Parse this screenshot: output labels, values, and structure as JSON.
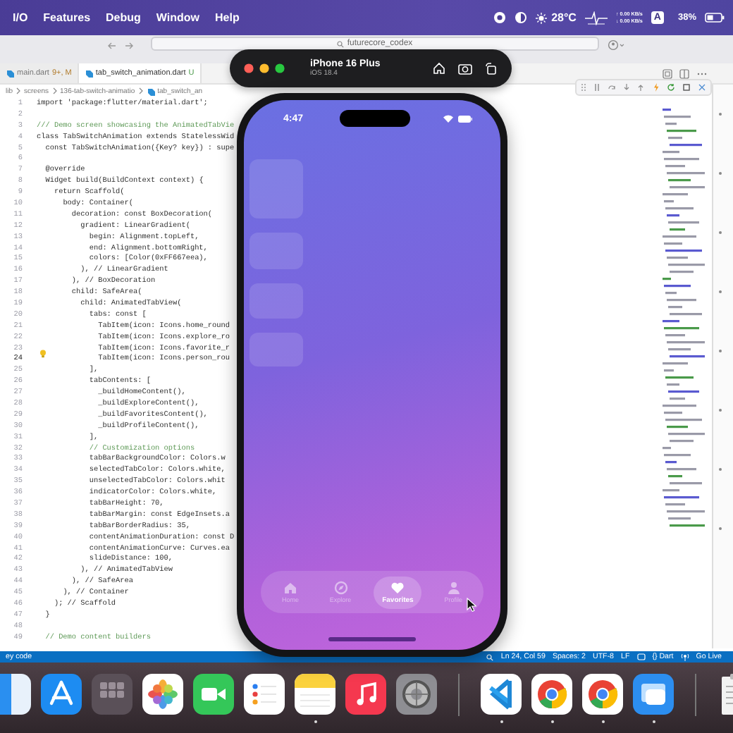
{
  "menu_bar": {
    "items": [
      "I/O",
      "Features",
      "Debug",
      "Window",
      "Help"
    ],
    "weather": "28°C",
    "net_up": "↑ 0.00 KB/s",
    "net_down": "↓ 0.00 KB/s",
    "input_source": "A",
    "battery": "38%"
  },
  "editor": {
    "search": "futurecore_codex",
    "tabs": [
      {
        "label": "main.dart",
        "badge": "9+, M",
        "selected": false
      },
      {
        "label": "tab_switch_animation.dart",
        "badge": "U",
        "selected": true
      }
    ],
    "breadcrumb": [
      "lib",
      "screens",
      "136-tab-switch-animatio",
      "tab_switch_an"
    ],
    "lines": [
      {
        "number": "1",
        "kind": "code",
        "text": "import 'package:flutter/material.dart';",
        "current": false
      },
      {
        "number": "2",
        "current": false
      },
      {
        "number": "3",
        "kind": "comment",
        "text": "/// Demo screen showcasing the AnimatedTabVie",
        "current": false
      },
      {
        "number": "4",
        "kind": "code",
        "text": "class TabSwitchAnimation extends StatelessWid",
        "current": false
      },
      {
        "number": "5",
        "kind": "code",
        "text": "  const TabSwitchAnimation({Key? key}) : supe",
        "current": false
      },
      {
        "number": "6",
        "current": false
      },
      {
        "number": "7",
        "kind": "code",
        "text": "  @override",
        "current": false
      },
      {
        "number": "8",
        "kind": "code",
        "text": "  Widget build(BuildContext context) {",
        "current": false
      },
      {
        "number": "9",
        "kind": "code",
        "text": "    return Scaffold(",
        "current": false
      },
      {
        "number": "10",
        "kind": "code",
        "text": "      body: Container(",
        "current": false
      },
      {
        "number": "11",
        "kind": "code",
        "text": "        decoration: const BoxDecoration(",
        "current": false
      },
      {
        "number": "12",
        "kind": "code",
        "text": "          gradient: LinearGradient(",
        "current": false
      },
      {
        "number": "13",
        "kind": "code",
        "text": "            begin: Alignment.topLeft,",
        "current": false
      },
      {
        "number": "14",
        "kind": "code",
        "text": "            end: Alignment.bottomRight,",
        "current": false
      },
      {
        "number": "15",
        "kind": "code",
        "text": "            colors: [Color(0xFF667eea),",
        "current": false
      },
      {
        "number": "16",
        "kind": "code",
        "text": "          ), // LinearGradient",
        "current": false
      },
      {
        "number": "17",
        "kind": "code",
        "text": "        ), // BoxDecoration",
        "current": false
      },
      {
        "number": "18",
        "kind": "code",
        "text": "        child: SafeArea(",
        "current": false
      },
      {
        "number": "19",
        "kind": "code",
        "text": "          child: AnimatedTabView(",
        "current": false
      },
      {
        "number": "20",
        "kind": "code",
        "text": "            tabs: const [",
        "current": false
      },
      {
        "number": "21",
        "kind": "code",
        "text": "              TabItem(icon: Icons.home_round",
        "current": false
      },
      {
        "number": "22",
        "kind": "code",
        "text": "              TabItem(icon: Icons.explore_ro",
        "current": false
      },
      {
        "number": "23",
        "kind": "code",
        "text": "              TabItem(icon: Icons.favorite_r",
        "current": false
      },
      {
        "number": "24",
        "kind": "code",
        "text": "              TabItem(icon: Icons.person_rou",
        "current": true
      },
      {
        "number": "25",
        "kind": "code",
        "text": "            ],",
        "current": false
      },
      {
        "number": "26",
        "kind": "code",
        "text": "            tabContents: [",
        "current": false
      },
      {
        "number": "27",
        "kind": "code",
        "text": "              _buildHomeContent(),",
        "current": false
      },
      {
        "number": "28",
        "kind": "code",
        "text": "              _buildExploreContent(),",
        "current": false
      },
      {
        "number": "29",
        "kind": "code",
        "text": "              _buildFavoritesContent(),",
        "current": false
      },
      {
        "number": "30",
        "kind": "code",
        "text": "              _buildProfileContent(),",
        "current": false
      },
      {
        "number": "31",
        "kind": "code",
        "text": "            ],",
        "current": false
      },
      {
        "number": "32",
        "kind": "comment",
        "text": "            // Customization options",
        "current": false
      },
      {
        "number": "33",
        "kind": "code",
        "text": "            tabBarBackgroundColor: Colors.w",
        "current": false
      },
      {
        "number": "34",
        "kind": "code",
        "text": "            selectedTabColor: Colors.white,",
        "current": false
      },
      {
        "number": "35",
        "kind": "code",
        "text": "            unselectedTabColor: Colors.whit",
        "current": false
      },
      {
        "number": "36",
        "kind": "code",
        "text": "            indicatorColor: Colors.white,",
        "current": false
      },
      {
        "number": "37",
        "kind": "code",
        "text": "            tabBarHeight: 70,",
        "current": false
      },
      {
        "number": "38",
        "kind": "code",
        "text": "            tabBarMargin: const EdgeInsets.a",
        "current": false
      },
      {
        "number": "39",
        "kind": "code",
        "text": "            tabBarBorderRadius: 35,",
        "current": false
      },
      {
        "number": "40",
        "kind": "code",
        "text": "            contentAnimationDuration: const D",
        "current": false
      },
      {
        "number": "41",
        "kind": "code",
        "text": "            contentAnimationCurve: Curves.ea",
        "current": false
      },
      {
        "number": "42",
        "kind": "code",
        "text": "            slideDistance: 100,",
        "current": false
      },
      {
        "number": "43",
        "kind": "code",
        "text": "          ), // AnimatedTabView",
        "current": false
      },
      {
        "number": "44",
        "kind": "code",
        "text": "        ), // SafeArea",
        "current": false
      },
      {
        "number": "45",
        "kind": "code",
        "text": "      ), // Container",
        "current": false
      },
      {
        "number": "46",
        "kind": "code",
        "text": "    ); // Scaffold",
        "current": false
      },
      {
        "number": "47",
        "kind": "code",
        "text": "  }",
        "current": false
      },
      {
        "number": "48",
        "current": false
      },
      {
        "number": "49",
        "kind": "comment",
        "text": "  // Demo content builders",
        "current": false
      }
    ],
    "status_left": "ey code",
    "status_items": [
      "Ln 24, Col 59",
      "Spaces: 2",
      "UTF-8",
      "LF",
      "{} Dart",
      "Go Live"
    ]
  },
  "simulator": {
    "device": "iPhone 16 Plus",
    "os": "iOS 18.4",
    "time": "4:47",
    "tabs": [
      {
        "label": "Home",
        "selected": false
      },
      {
        "label": "Explore",
        "selected": false
      },
      {
        "label": "Favorites",
        "selected": true
      },
      {
        "label": "Profile",
        "selected": false
      }
    ]
  },
  "dock": [
    {
      "kind": "finder",
      "running": false
    },
    {
      "kind": "store",
      "running": false
    },
    {
      "kind": "launchpad",
      "running": false
    },
    {
      "kind": "photos",
      "running": false
    },
    {
      "kind": "video",
      "running": false
    },
    {
      "kind": "reminders",
      "running": false
    },
    {
      "kind": "notes",
      "running": true
    },
    {
      "kind": "music",
      "running": false
    },
    {
      "kind": "settings",
      "running": false
    },
    {
      "kind": "separator"
    },
    {
      "kind": "code",
      "running": true
    },
    {
      "kind": "chrome",
      "running": true
    },
    {
      "kind": "chrome",
      "running": true
    },
    {
      "kind": "window",
      "running": true
    },
    {
      "kind": "separator"
    },
    {
      "kind": "document"
    }
  ]
}
